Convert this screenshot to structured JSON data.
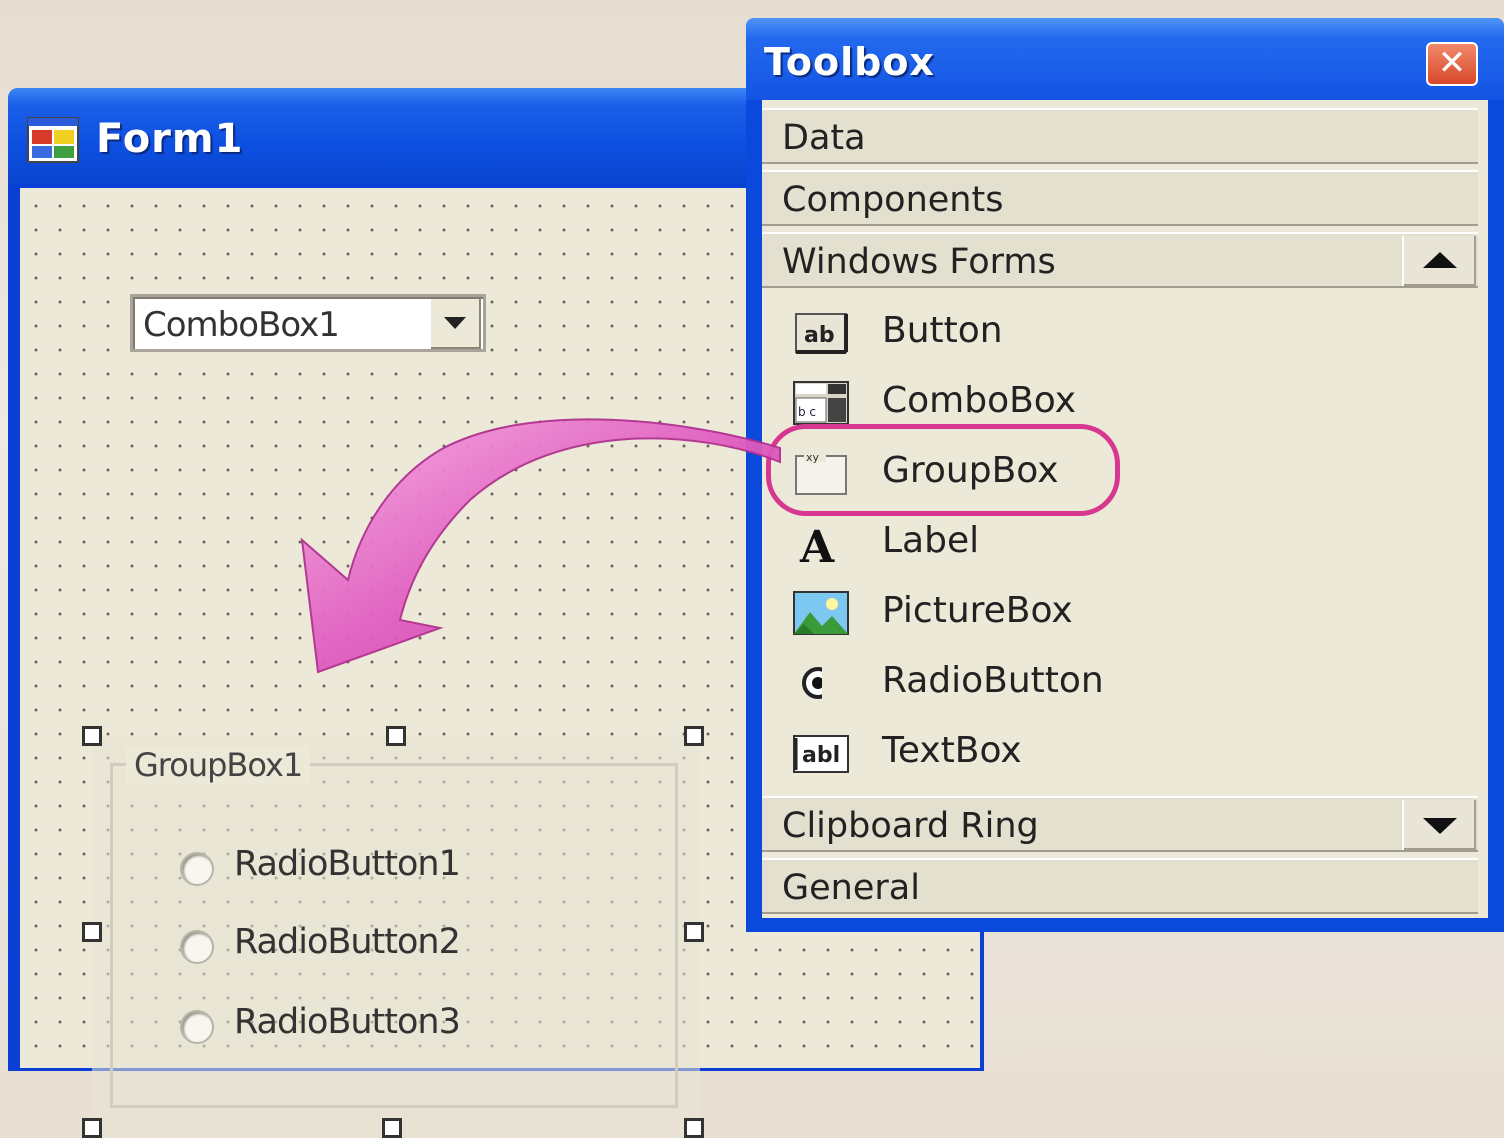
{
  "form": {
    "title": "Form1",
    "combo_text": "ComboBox1",
    "group_title": "GroupBox1",
    "radios": [
      "RadioButton1",
      "RadioButton2",
      "RadioButton3"
    ]
  },
  "toolbox": {
    "title": "Toolbox",
    "close_glyph": "✕",
    "sections_top": [
      "Data",
      "Components",
      "Windows Forms"
    ],
    "items": [
      {
        "label": "Button",
        "icon": "button-icon"
      },
      {
        "label": "ComboBox",
        "icon": "combobox-icon"
      },
      {
        "label": "GroupBox",
        "icon": "groupbox-icon"
      },
      {
        "label": "Label",
        "icon": "label-icon"
      },
      {
        "label": "PictureBox",
        "icon": "picturebox-icon"
      },
      {
        "label": "RadioButton",
        "icon": "radiobutton-icon"
      },
      {
        "label": "TextBox",
        "icon": "textbox-icon"
      }
    ],
    "sections_bottom": [
      "Clipboard Ring",
      "General"
    ]
  },
  "colors": {
    "xp_blue": "#0a45d0",
    "form_bg": "#ece9d8",
    "highlight": "#d8378f",
    "arrow": "#e05cc0"
  }
}
